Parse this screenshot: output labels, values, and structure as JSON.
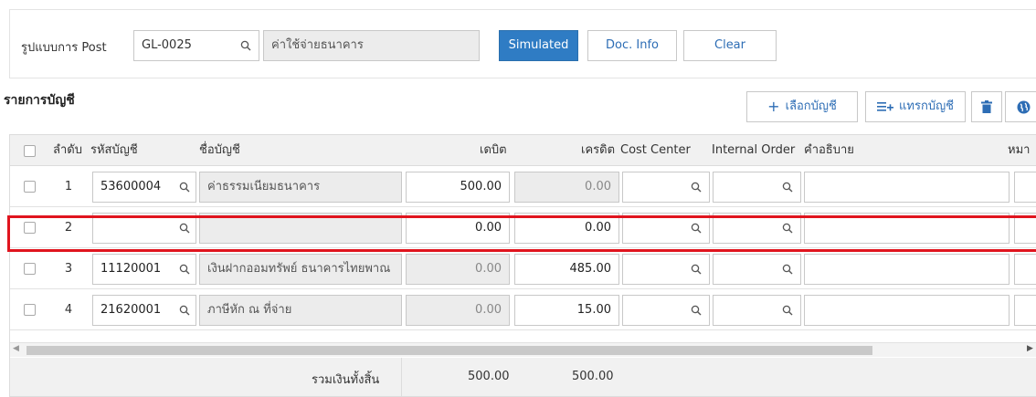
{
  "top": {
    "post_label": "รูปแบบการ Post",
    "post_code": "GL-0025",
    "post_name": "ค่าใช้จ่ายธนาคาร",
    "simulated_label": "Simulated",
    "docinfo_label": "Doc. Info",
    "clear_label": "Clear"
  },
  "section": {
    "title": "รายการบัญชี",
    "select_account_label": "เลือกบัญชี",
    "insert_account_label": "แทรกบัญชี"
  },
  "table": {
    "headers": {
      "seq": "ลำดับ",
      "code": "รหัสบัญชี",
      "name": "ชื่อบัญชี",
      "debit": "เดบิต",
      "credit": "เครดิต",
      "cost_center": "Cost Center",
      "internal_order": "Internal Order",
      "description": "คำอธิบาย",
      "remark": "หมา"
    },
    "rows": [
      {
        "seq": "1",
        "code": "53600004",
        "name": "ค่าธรรมเนียมธนาคาร",
        "debit": "500.00",
        "credit": "0.00"
      },
      {
        "seq": "2",
        "code": "",
        "name": "",
        "debit": "0.00",
        "credit": "0.00"
      },
      {
        "seq": "3",
        "code": "11120001",
        "name": "เงินฝากออมทรัพย์ ธนาคารไทยพาณ",
        "debit": "0.00",
        "credit": "485.00"
      },
      {
        "seq": "4",
        "code": "21620001",
        "name": "ภาษีหัก ณ ที่จ่าย",
        "debit": "0.00",
        "credit": "15.00"
      }
    ],
    "total": {
      "label": "รวมเงินทั้งสิ้น",
      "debit": "500.00",
      "credit": "500.00"
    }
  },
  "colors": {
    "accent": "#2f7cc4",
    "highlight": "#e0141e"
  }
}
